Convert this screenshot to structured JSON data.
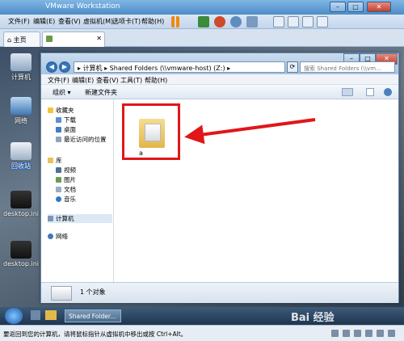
{
  "vmware": {
    "title": "VMware Workstation",
    "menu": [
      "文件(F)",
      "编辑(E)",
      "查看(V)",
      "虚拟机(M)",
      "选项卡(T)",
      "帮助(H)"
    ],
    "tabs": {
      "home": "主页"
    }
  },
  "desktop_icons": [
    "计算机",
    "网络",
    "回收站",
    "desktop.ini",
    "desktop.ini"
  ],
  "explorer": {
    "breadcrumb": [
      "计算机",
      "Shared Folders (\\\\vmware-host) (Z:)"
    ],
    "search_placeholder": "搜索 Shared Folders (\\\\vm...",
    "menu": [
      "文件(F)",
      "编辑(E)",
      "查看(V)",
      "工具(T)",
      "帮助(H)"
    ],
    "toolbar": {
      "organize": "组织 ▾",
      "new_folder": "新建文件夹"
    },
    "nav": {
      "favorites": "收藏夹",
      "favorites_items": [
        "下载",
        "桌面",
        "最近访问的位置"
      ],
      "libraries": "库",
      "libraries_items": [
        "视频",
        "图片",
        "文档",
        "音乐"
      ],
      "computer": "计算机",
      "network": "网络"
    },
    "files": [
      {
        "name": "a"
      }
    ],
    "details": "1 个对象"
  },
  "taskbar": {
    "task_label": "Shared Folder...",
    "watermark": "Bai 经验"
  },
  "statusbar": "要返回到您的计算机，请将鼠标指针从虚拟机中移出或按 Ctrl+Alt。",
  "colors": {
    "highlight": "#e0161a",
    "arrow": "#e0161a"
  }
}
